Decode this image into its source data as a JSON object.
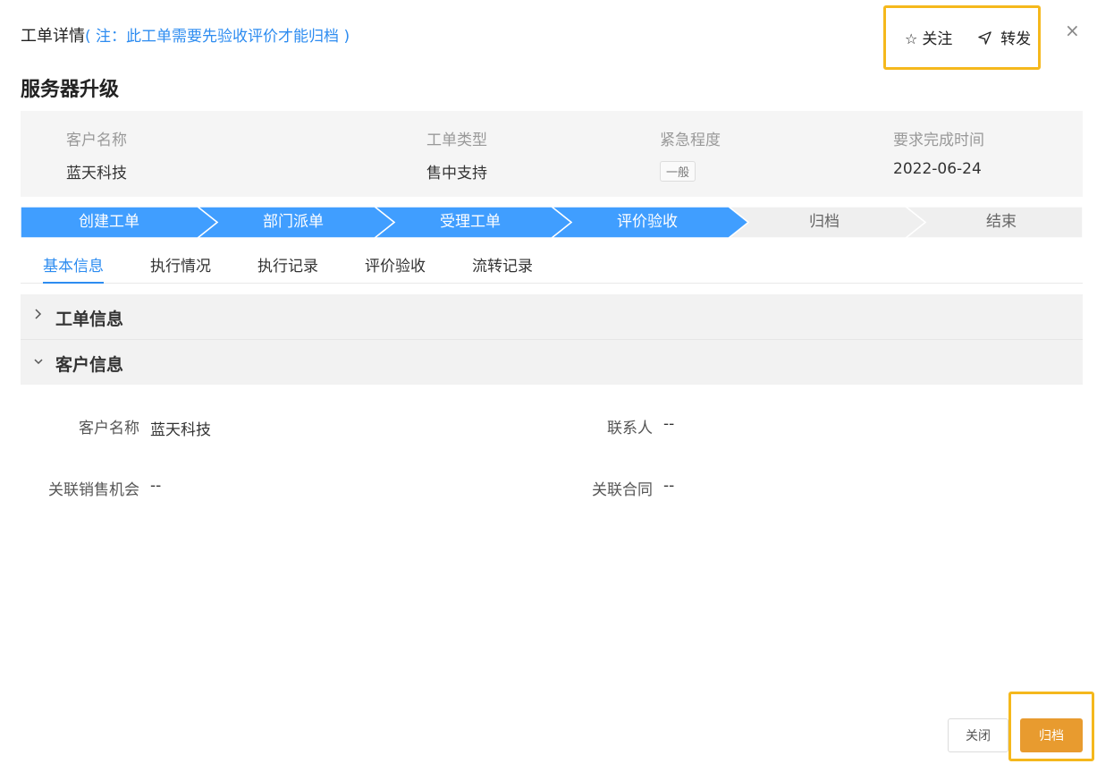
{
  "header": {
    "title": "工单详情",
    "note": "( 注：此工单需要先验收评价才能归档 )",
    "follow_label": "关注",
    "forward_label": "转发",
    "close_symbol": "×"
  },
  "subject": "服务器升级",
  "summary": [
    {
      "label": "客户名称",
      "value": "蓝天科技"
    },
    {
      "label": "工单类型",
      "value": "售中支持"
    },
    {
      "label": "紧急程度",
      "value": "一般"
    },
    {
      "label": "要求完成时间",
      "value": "2022-06-24"
    }
  ],
  "steps": [
    {
      "label": "创建工单",
      "done": true
    },
    {
      "label": "部门派单",
      "done": true
    },
    {
      "label": "受理工单",
      "done": true
    },
    {
      "label": "评价验收",
      "done": true
    },
    {
      "label": "归档",
      "done": false
    },
    {
      "label": "结束",
      "done": false
    }
  ],
  "colors": {
    "step_active": "#409eff",
    "step_inactive": "#efefef",
    "accent": "#2d8cf0",
    "archive": "#e89b2f",
    "highlight": "#f5b81c"
  },
  "tabs": [
    "基本信息",
    "执行情况",
    "执行记录",
    "评价验收",
    "流转记录"
  ],
  "sections": [
    {
      "title": "工单信息",
      "expanded": false
    },
    {
      "title": "客户信息",
      "expanded": true
    }
  ],
  "customer_fields": [
    {
      "label": "客户名称",
      "value": "蓝天科技"
    },
    {
      "label": "联系人",
      "value": "--"
    },
    {
      "label": "关联销售机会",
      "value": "--"
    },
    {
      "label": "关联合同",
      "value": "--"
    }
  ],
  "footer": {
    "close_label": "关闭",
    "archive_label": "归档"
  }
}
